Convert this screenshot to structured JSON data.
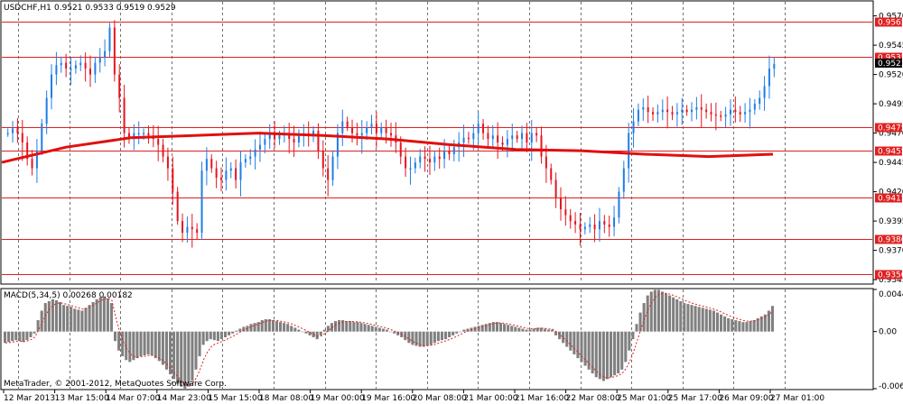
{
  "chart_data": {
    "type": "candlestick",
    "symbol_label": "USDCHF,H1",
    "ohlc_label": "0.9521 0.9533 0.9519 0.9529",
    "current_price": "0.9523",
    "price_axis": {
      "ylim": [
        0.9342,
        0.9582
      ],
      "ticks": [
        "0.9570",
        "0.9545",
        "0.9520",
        "0.9495",
        "0.9470",
        "0.9445",
        "0.9420",
        "0.9395",
        "0.9370",
        "0.9345"
      ]
    },
    "levels": [
      "0.9565",
      "0.9535",
      "0.9475",
      "0.9455",
      "0.9415",
      "0.9380",
      "0.9350"
    ],
    "level_values": [
      0.9565,
      0.9535,
      0.9475,
      0.9455,
      0.9415,
      0.938,
      0.935
    ],
    "time_labels": [
      "12 Mar 2013",
      "13 Mar 15:00",
      "14 Mar 07:00",
      "14 Mar 23:00",
      "15 Mar 15:00",
      "18 Mar 08:00",
      "19 Mar 00:00",
      "19 Mar 16:00",
      "20 Mar 08:00",
      "21 Mar 00:00",
      "21 Mar 16:00",
      "22 Mar 08:00",
      "25 Mar 01:00",
      "25 Mar 17:00",
      "26 Mar 09:00",
      "27 Mar 01:00"
    ],
    "price_path": [
      [
        0.947,
        0.9474,
        0.947,
        0.9462,
        0.9448,
        0.944,
        0.9455,
        0.9478,
        0.95,
        0.952,
        0.9528,
        0.953,
        0.9525,
        0.9525,
        0.9528,
        0.953,
        0.9525,
        0.952,
        0.953,
        0.9535,
        0.954,
        0.956,
        0.952,
        0.95,
        0.947,
        0.9465,
        0.947,
        0.947,
        0.947,
        0.9468,
        0.9465,
        0.946
      ],
      [
        0.945,
        0.944,
        0.942,
        0.9395,
        0.9385,
        0.939,
        0.9388,
        0.9385,
        0.9438,
        0.9448,
        0.944,
        0.9432,
        0.943,
        0.9438,
        0.944,
        0.943,
        0.9445,
        0.9448,
        0.945,
        0.9456,
        0.946,
        0.9465,
        0.947,
        0.9465,
        0.9468,
        0.947,
        0.9465,
        0.9462,
        0.9468,
        0.947,
        0.9468,
        0.9472
      ],
      [
        0.9455,
        0.944,
        0.943,
        0.945,
        0.947,
        0.948,
        0.9475,
        0.947,
        0.9468,
        0.947,
        0.9475,
        0.9478,
        0.947,
        0.9475,
        0.947,
        0.9468,
        0.9462,
        0.945,
        0.944,
        0.944,
        0.9445,
        0.945,
        0.9448,
        0.9445,
        0.945,
        0.9448,
        0.9455,
        0.9452,
        0.9458,
        0.9462,
        0.9466,
        0.9465
      ],
      [
        0.947,
        0.9478,
        0.947,
        0.9465,
        0.9468,
        0.9462,
        0.946,
        0.9465,
        0.9468,
        0.9465,
        0.947,
        0.9462,
        0.947,
        0.9468,
        0.945,
        0.944,
        0.943,
        0.9415,
        0.9405,
        0.94,
        0.9395,
        0.9392,
        0.9388,
        0.939,
        0.9392,
        0.9388,
        0.9395,
        0.9392,
        0.939,
        0.9398,
        0.942,
        0.944
      ],
      [
        0.947,
        0.948,
        0.949,
        0.9492,
        0.9488,
        0.9486,
        0.9488,
        0.949,
        0.9488,
        0.9486,
        0.9488,
        0.949,
        0.9488,
        0.949,
        0.9492,
        0.949,
        0.9488,
        0.9486,
        0.9485,
        0.9484,
        0.9486,
        0.949,
        0.9488,
        0.9486,
        0.9488,
        0.949,
        0.9495,
        0.95,
        0.951,
        0.9525,
        0.9529
      ]
    ],
    "ma_path": [
      0.9445,
      0.9458,
      0.9466,
      0.9468,
      0.947,
      0.9468,
      0.9465,
      0.946,
      0.9456,
      0.9455,
      0.9452,
      0.945,
      0.9452
    ],
    "macd": {
      "label": "MACD(5,34,5) 0.00268 0.00182",
      "ylim": [
        -0.00601,
        0.00443
      ],
      "ticks": [
        "0.00443",
        "0.00",
        "-0.00601"
      ],
      "histogram": [
        -0.0012,
        -0.0011,
        -0.001,
        -0.0009,
        -0.001,
        -0.0011,
        -0.0009,
        -0.0006,
        -0.0002,
        0.0012,
        0.0022,
        0.003,
        0.0032,
        0.0034,
        0.0033,
        0.0031,
        0.0028,
        0.0027,
        0.0026,
        0.0024,
        0.0023,
        0.0022,
        0.0025,
        0.0028,
        0.0031,
        0.0034,
        0.0036,
        0.0037,
        0.0035,
        0.003,
        -0.001,
        -0.002,
        -0.0026,
        -0.003,
        -0.0032,
        -0.003,
        -0.0028,
        -0.0026,
        -0.0025,
        -0.0024,
        -0.0025,
        -0.0028,
        -0.0031,
        -0.0035,
        -0.004,
        -0.0045,
        -0.005,
        -0.0055,
        -0.0058,
        -0.006,
        -0.0058,
        -0.0052,
        -0.004,
        -0.0026,
        -0.0014,
        -0.001,
        -0.0008,
        -0.0009,
        -0.001,
        -0.0008,
        -0.0006,
        -0.0004,
        -0.0002,
        0.0001,
        0.0003,
        0.0005,
        0.0006,
        0.0008,
        0.0009,
        0.001,
        0.0012,
        0.0013,
        0.0013,
        0.0012,
        0.0011,
        0.001,
        0.0009,
        0.0008,
        0.0006,
        0.0004,
        0.0002,
        0.0,
        -0.0002,
        -0.0004,
        -0.0006,
        -0.0008,
        -0.0004,
        0.0002,
        0.0006,
        0.0009,
        0.0011,
        0.0012,
        0.0012,
        0.0011,
        0.0011,
        0.001,
        0.001,
        0.0009,
        0.0008,
        0.0007,
        0.0006,
        0.0005,
        0.0004,
        0.0003,
        0.0002,
        0.0,
        -0.0002,
        -0.0004,
        -0.0006,
        -0.0009,
        -0.0012,
        -0.0014,
        -0.0015,
        -0.0016,
        -0.0016,
        -0.0015,
        -0.0014,
        -0.0012,
        -0.001,
        -0.0009,
        -0.0008,
        -0.0006,
        -0.0004,
        -0.0002,
        0.0,
        0.0002,
        0.0003,
        0.0004,
        0.0005,
        0.0006,
        0.0007,
        0.0008,
        0.0009,
        0.001,
        0.001,
        0.0009,
        0.0008,
        0.0007,
        0.0006,
        0.0005,
        0.0004,
        0.0003,
        0.0002,
        0.0002,
        0.0003,
        0.0004,
        0.0004,
        0.0003,
        0.0002,
        0.0002,
        -0.0004,
        -0.0008,
        -0.0012,
        -0.0016,
        -0.002,
        -0.0024,
        -0.0028,
        -0.0032,
        -0.0036,
        -0.004,
        -0.0044,
        -0.0048,
        -0.005,
        -0.0052,
        -0.005,
        -0.0048,
        -0.0046,
        -0.0044,
        -0.004,
        -0.0032,
        -0.002,
        -0.0008,
        0.0008,
        0.002,
        0.003,
        0.0038,
        0.0042,
        0.0044,
        0.0044,
        0.0042,
        0.004,
        0.0038,
        0.0036,
        0.0034,
        0.0032,
        0.003,
        0.0029,
        0.0028,
        0.0027,
        0.0026,
        0.0025,
        0.0024,
        0.0023,
        0.0022,
        0.002,
        0.0018,
        0.0016,
        0.0014,
        0.0013,
        0.0012,
        0.0011,
        0.001,
        0.001,
        0.0011,
        0.0012,
        0.0014,
        0.0016,
        0.0018,
        0.0022,
        0.0027
      ]
    },
    "colors": {
      "bull": "#1e7ee6",
      "bear": "#e6141e",
      "ma": "#e01010",
      "level": "#e02020",
      "macd_hist": "#808080",
      "macd_signal": "#e02020",
      "grid": "#000000",
      "background": "#ffffff"
    }
  },
  "footer": {
    "copyright": "MetaTrader, © 2001-2012, MetaQuotes Software Corp."
  }
}
